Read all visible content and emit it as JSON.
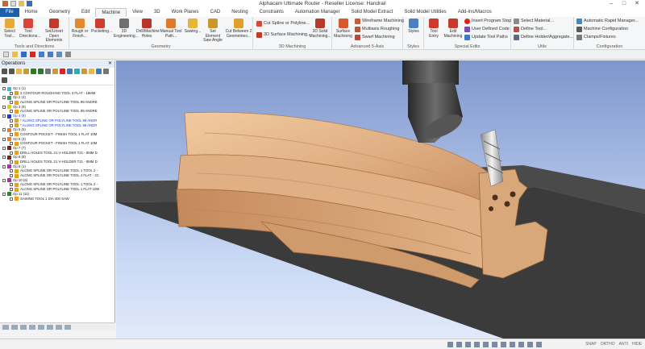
{
  "window": {
    "title": "Alphacam Ultimate Router - Reseller License: Handrail"
  },
  "tabs": [
    "File",
    "Home",
    "Geometry",
    "Edit",
    "Machine",
    "View",
    "3D",
    "Work Planes",
    "CAD",
    "Nesting",
    "Constraints",
    "Automation Manager",
    "Solid Model Extract",
    "Solid Model Utilities",
    "Add-Ins/Macros"
  ],
  "ribbon": {
    "groups": {
      "tools_directions": "Tools and Directions",
      "geometry": "Geometry",
      "machining_3d": "3D Machining",
      "adv5axis": "Advanced 5-Axis",
      "styles": "Styles",
      "special_edits": "Special Edits",
      "utils": "Utils",
      "configuration": "Configuration"
    },
    "buttons": {
      "select_tool": "Select Tool...",
      "tool_directions": "Tool Directions...",
      "set_unset": "Set/Unset Open Elements",
      "rough_finish": "Rough or Finish...",
      "pocketing": "Pocketing...",
      "engineering_3d": "3D Engineering...",
      "drill_holes": "Drill/Machine Holes",
      "manual_tool_path": "Manual Tool Path...",
      "sawing": "Sawing...",
      "set_element_saw": "Set Element Saw Angle",
      "cut_between": "Cut Between 2 Geometries...",
      "cut_spline": "Cut Spline or Polyline...",
      "surface_machining_3d": "3D Surface Machining...",
      "solid_machining_3d": "3D Solid Machining...",
      "surface_machining": "Surface Machining",
      "wireframe_machining": "Wireframe Machining",
      "multiaxis_roughing": "Multiaxis Roughing",
      "swarf_machining": "Swarf Machining",
      "styles": "Styles",
      "tool_entry": "Tool Entry",
      "edit_machining": "Edit Machining",
      "insert_stop": "Insert Program Stop",
      "user_code": "User Defined Code",
      "update_paths": "Update Tool Paths",
      "select_material": "Select Material...",
      "define_tool": "Define Tool...",
      "define_holder": "Define Holder/Aggregate...",
      "auto_rapid": "Automatic Rapid Manager...",
      "machine_config": "Machine Configuration",
      "clamps": "Clamps/Fixtures"
    }
  },
  "operations": {
    "title": "Operations",
    "rows": [
      {
        "text": "Op 1  (1)",
        "level": 0,
        "color": "#3fb4e6"
      },
      {
        "text": "2 CONTOUR ROUGHING   TOOL 3   FLAT - 18MM",
        "level": 1,
        "color": "#e1a12b"
      },
      {
        "text": "Op 2  (4)",
        "level": 0,
        "color": "#2aa84a"
      },
      {
        "text": "ALONG SPLINE OR POLYLINE   TOOL 99   ANDRE",
        "level": 1,
        "color": "#e1a12b"
      },
      {
        "text": "Op 3  (5)",
        "level": 0,
        "color": "#e8c81f"
      },
      {
        "text": "ALONG SPLINE OR POLYLINE   TOOL 99   ANDRE",
        "level": 1,
        "color": "#e1a12b"
      },
      {
        "text": "Op 4  (9)",
        "level": 0,
        "color": "#1a3dc8",
        "blue": true
      },
      {
        "text": "* ALONG SPLINE OR POLYLINE   TOOL 99   ANDR",
        "level": 1,
        "color": "#e1a12b",
        "blue": true
      },
      {
        "text": "* ALONG SPLINE OR POLYLINE   TOOL 98   ANDR",
        "level": 1,
        "color": "#e1a12b",
        "blue": true
      },
      {
        "text": "Op 5  (5)",
        "level": 0,
        "color": "#f07a1c"
      },
      {
        "text": "CONTOUR POCKET - FINISH   TOOL 1   FLAT 10M",
        "level": 1,
        "color": "#e1a12b"
      },
      {
        "text": "Op 6  (3)",
        "level": 0,
        "color": "#f07a1c"
      },
      {
        "text": "CONTOUR POCKET - FINISH   TOOL 1   FLAT 10M",
        "level": 1,
        "color": "#e1a12b"
      },
      {
        "text": "Op 7  (7)",
        "level": 0,
        "color": "#8b1a1a"
      },
      {
        "text": "DRILL HOLES   TOOL 21   V-HOLDER T21 - 8MM D",
        "level": 1,
        "color": "#e1a12b"
      },
      {
        "text": "Op 8  (8)",
        "level": 0,
        "color": "#8b1a1a"
      },
      {
        "text": "DRILL HOLES   TOOL 21   V-HOLDER T21 - 8MM D",
        "level": 1,
        "color": "#e1a12b"
      },
      {
        "text": "Op 9  (1)",
        "level": 0,
        "color": "#c020c0"
      },
      {
        "text": "ALONG SPLINE OR POLYLINE   TOOL 1   TOOL 2 -",
        "level": 1,
        "color": "#e1a12b"
      },
      {
        "text": "ALONG SPLINE OR POLYLINE   TOOL 4   FLAT - 2C",
        "level": 1,
        "color": "#e1a12b"
      },
      {
        "text": "Op 10  (6)",
        "level": 0,
        "color": "#c020c0"
      },
      {
        "text": "ALONG SPLINE OR POLYLINE   TOOL 1   TOOL 2 -",
        "level": 1,
        "color": "#e1a12b"
      },
      {
        "text": "ALONG SPLINE OR POLYLINE   TOOL 1   FLAT 10M",
        "level": 1,
        "color": "#e1a12b"
      },
      {
        "text": "Op 11  (11)",
        "level": 0,
        "color": "#2a8a2a"
      },
      {
        "text": "SAWING   TOOL 1   DIA 400 SAW",
        "level": 1,
        "color": "#e1a12b"
      }
    ]
  },
  "status": {
    "modes": [
      "SNAP",
      "ORTHO",
      "ANTI",
      "HIDE"
    ]
  },
  "colors": {
    "file_tab": "#1e5fa8",
    "viewport_top": "#7d96cd",
    "viewport_bottom": "#e1eafa",
    "table": "#3b3b3b",
    "wood": "#d8a77a"
  }
}
